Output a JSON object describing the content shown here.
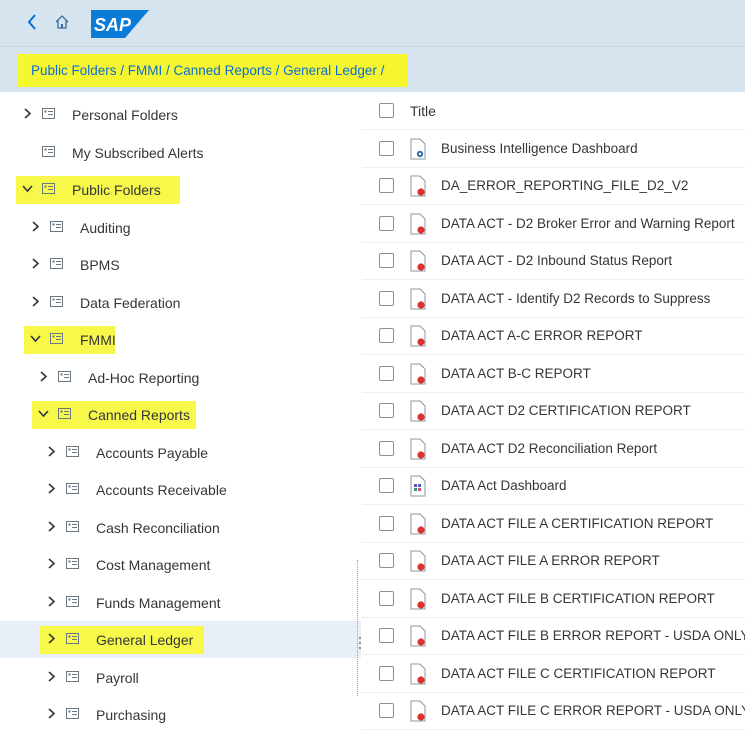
{
  "breadcrumb": {
    "path": "Public Folders / FMMI / Canned Reports / General Ledger /"
  },
  "logo": {
    "text": "SAP"
  },
  "tree": {
    "items": [
      {
        "label": "Personal Folders",
        "expander": "collapsed",
        "highlighted": false,
        "selected": false
      },
      {
        "label": "My Subscribed Alerts",
        "expander": "none",
        "highlighted": false,
        "selected": false
      },
      {
        "label": "Public Folders",
        "expander": "expanded",
        "highlighted": true,
        "selected": false
      },
      {
        "label": "Auditing",
        "expander": "collapsed",
        "highlighted": false,
        "selected": false
      },
      {
        "label": "BPMS",
        "expander": "collapsed",
        "highlighted": false,
        "selected": false
      },
      {
        "label": "Data Federation",
        "expander": "collapsed",
        "highlighted": false,
        "selected": false
      },
      {
        "label": "FMMI",
        "expander": "expanded",
        "highlighted": true,
        "selected": false
      },
      {
        "label": "Ad-Hoc Reporting",
        "expander": "collapsed",
        "highlighted": false,
        "selected": false
      },
      {
        "label": "Canned Reports",
        "expander": "expanded",
        "highlighted": true,
        "selected": false
      },
      {
        "label": "Accounts Payable",
        "expander": "collapsed",
        "highlighted": false,
        "selected": false
      },
      {
        "label": "Accounts Receivable",
        "expander": "collapsed",
        "highlighted": false,
        "selected": false
      },
      {
        "label": "Cash Reconciliation",
        "expander": "collapsed",
        "highlighted": false,
        "selected": false
      },
      {
        "label": "Cost Management",
        "expander": "collapsed",
        "highlighted": false,
        "selected": false
      },
      {
        "label": "Funds Management",
        "expander": "collapsed",
        "highlighted": false,
        "selected": false
      },
      {
        "label": "General Ledger",
        "expander": "collapsed",
        "highlighted": true,
        "selected": true
      },
      {
        "label": "Payroll",
        "expander": "collapsed",
        "highlighted": false,
        "selected": false
      },
      {
        "label": "Purchasing",
        "expander": "collapsed",
        "highlighted": false,
        "selected": false
      }
    ]
  },
  "table": {
    "header": {
      "title": "Title"
    },
    "rows": [
      {
        "title": "Business Intelligence Dashboard",
        "icon": "bi-dashboard-icon"
      },
      {
        "title": "DA_ERROR_REPORTING_FILE_D2_V2",
        "icon": "report-icon"
      },
      {
        "title": "DATA ACT - D2 Broker Error and Warning Report",
        "icon": "report-icon"
      },
      {
        "title": "DATA ACT - D2 Inbound Status Report",
        "icon": "report-icon"
      },
      {
        "title": "DATA ACT - Identify D2 Records to Suppress",
        "icon": "report-icon"
      },
      {
        "title": "DATA ACT A-C ERROR REPORT",
        "icon": "report-icon"
      },
      {
        "title": "DATA ACT B-C REPORT",
        "icon": "report-icon"
      },
      {
        "title": "DATA ACT D2 CERTIFICATION REPORT",
        "icon": "report-icon"
      },
      {
        "title": "DATA ACT D2 Reconciliation Report",
        "icon": "report-icon"
      },
      {
        "title": "DATA Act Dashboard",
        "icon": "dashboard-icon"
      },
      {
        "title": "DATA ACT FILE A CERTIFICATION REPORT",
        "icon": "report-icon"
      },
      {
        "title": "DATA ACT FILE A ERROR REPORT",
        "icon": "report-icon"
      },
      {
        "title": "DATA ACT FILE B CERTIFICATION REPORT",
        "icon": "report-icon"
      },
      {
        "title": "DATA ACT FILE B ERROR REPORT - USDA ONLY",
        "icon": "report-icon"
      },
      {
        "title": "DATA ACT FILE C CERTIFICATION REPORT",
        "icon": "report-icon"
      },
      {
        "title": "DATA ACT FILE C ERROR REPORT - USDA ONLY",
        "icon": "report-icon"
      }
    ]
  },
  "colors": {
    "link": "#0a6ed1",
    "highlight": "#f8f84a",
    "header_bg": "#d6e4f0",
    "report_accent": "#e0302b",
    "selected_row": "#e8eff6"
  }
}
